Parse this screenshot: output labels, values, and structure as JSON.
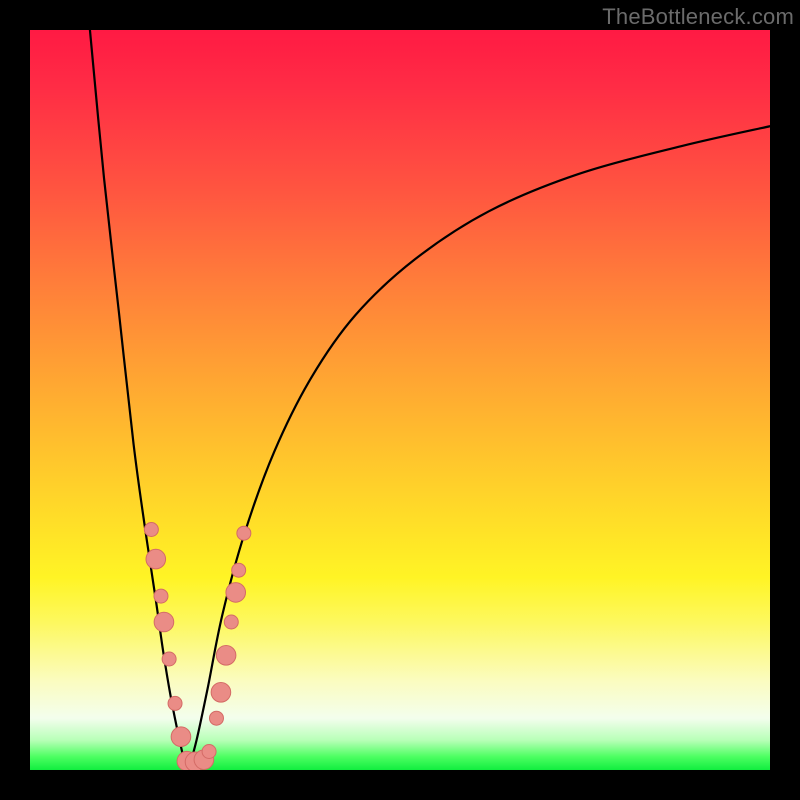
{
  "watermark": "TheBottleneck.com",
  "colors": {
    "curve": "#000000",
    "dots_fill": "#ea8c86",
    "dots_stroke": "#d46b66",
    "background_black": "#000000"
  },
  "chart_data": {
    "type": "line",
    "title": "",
    "xlabel": "",
    "ylabel": "",
    "xlim": [
      0,
      100
    ],
    "ylim": [
      0,
      100
    ],
    "grid": false,
    "legend": false,
    "note": "Bottleneck-style curve. No axes or tick labels are visible in the image; values below are percentage units estimated from pixel positions (0 = far left/bottom, 100 = far right/top). Minimum sits near x≈21.",
    "series": [
      {
        "name": "left_branch",
        "x": [
          8.1,
          10.0,
          12.0,
          14.0,
          15.5,
          17.0,
          18.0,
          19.0,
          20.0,
          20.8,
          21.4
        ],
        "y": [
          100.0,
          80.0,
          62.0,
          44.0,
          33.0,
          23.0,
          16.0,
          10.0,
          5.0,
          1.5,
          0.0
        ]
      },
      {
        "name": "right_branch",
        "x": [
          21.4,
          22.5,
          24.0,
          26.0,
          29.0,
          33.0,
          38.0,
          44.0,
          52.0,
          62.0,
          74.0,
          88.0,
          100.0
        ],
        "y": [
          0.0,
          4.0,
          11.0,
          21.0,
          32.0,
          43.0,
          53.0,
          61.5,
          69.0,
          75.5,
          80.5,
          84.3,
          87.0
        ]
      }
    ],
    "scatter": {
      "name": "dots",
      "points": [
        {
          "x": 16.4,
          "y": 32.5,
          "r": 1.0
        },
        {
          "x": 17.0,
          "y": 28.5,
          "r": 1.4
        },
        {
          "x": 17.7,
          "y": 23.5,
          "r": 1.0
        },
        {
          "x": 18.1,
          "y": 20.0,
          "r": 1.4
        },
        {
          "x": 18.8,
          "y": 15.0,
          "r": 1.0
        },
        {
          "x": 19.6,
          "y": 9.0,
          "r": 1.0
        },
        {
          "x": 20.4,
          "y": 4.5,
          "r": 1.4
        },
        {
          "x": 21.2,
          "y": 1.2,
          "r": 1.4
        },
        {
          "x": 22.3,
          "y": 1.1,
          "r": 1.4
        },
        {
          "x": 23.5,
          "y": 1.4,
          "r": 1.4
        },
        {
          "x": 24.2,
          "y": 2.5,
          "r": 1.0
        },
        {
          "x": 25.2,
          "y": 7.0,
          "r": 1.0
        },
        {
          "x": 25.8,
          "y": 10.5,
          "r": 1.4
        },
        {
          "x": 26.5,
          "y": 15.5,
          "r": 1.4
        },
        {
          "x": 27.2,
          "y": 20.0,
          "r": 1.0
        },
        {
          "x": 27.8,
          "y": 24.0,
          "r": 1.4
        },
        {
          "x": 28.2,
          "y": 27.0,
          "r": 1.0
        },
        {
          "x": 28.9,
          "y": 32.0,
          "r": 1.0
        }
      ]
    }
  }
}
